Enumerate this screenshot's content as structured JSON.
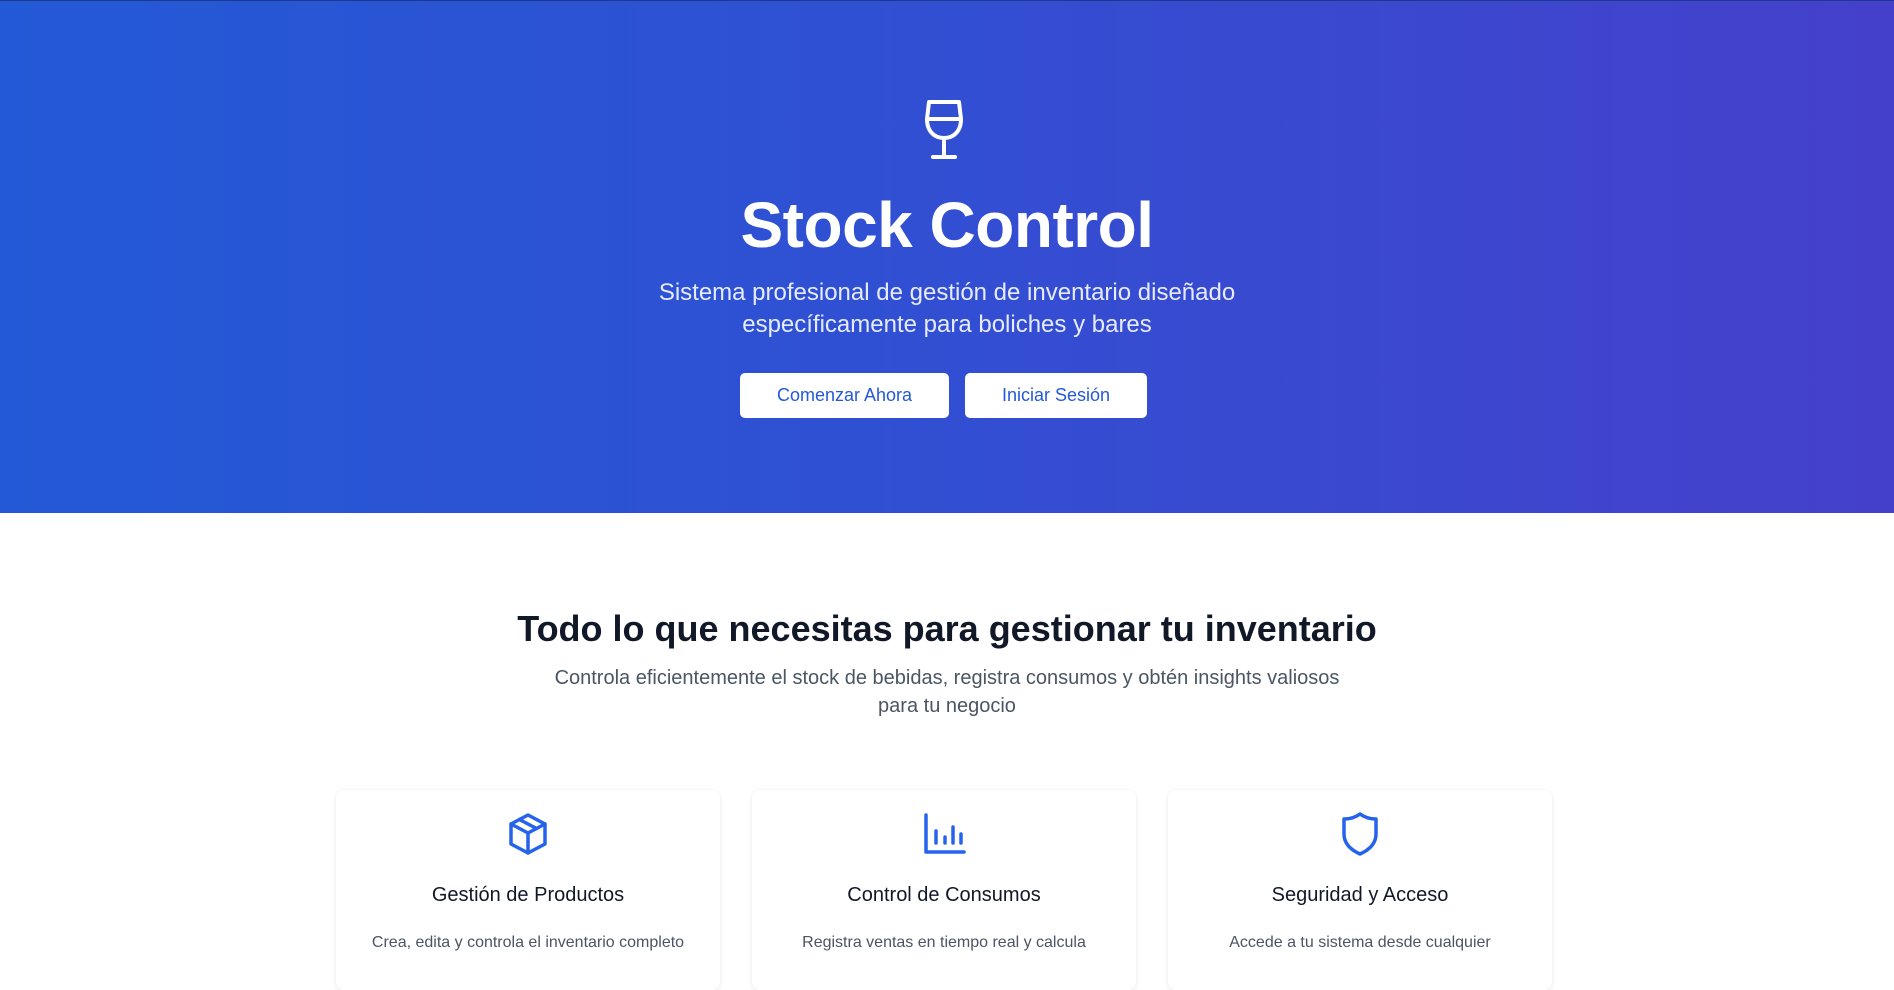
{
  "hero": {
    "icon": "wine-glass-icon",
    "title": "Stock Control",
    "subtitle": "Sistema profesional de gestión de inventario diseñado específicamente para boliches y bares",
    "buttons": {
      "start_label": "Comenzar Ahora",
      "login_label": "Iniciar Sesión"
    },
    "gradient_colors": [
      "#2359d6",
      "#4540cc"
    ]
  },
  "features": {
    "title": "Todo lo que necesitas para gestionar tu inventario",
    "subtitle": "Controla eficientemente el stock de bebidas, registra consumos y obtén insights valiosos para tu negocio",
    "accent_color": "#2563eb",
    "cards": [
      {
        "icon": "package-icon",
        "title": "Gestión de Productos",
        "text": "Crea, edita y controla el inventario completo"
      },
      {
        "icon": "bar-chart-icon",
        "title": "Control de Consumos",
        "text": "Registra ventas en tiempo real y calcula"
      },
      {
        "icon": "shield-icon",
        "title": "Seguridad y Acceso",
        "text": "Accede a tu sistema desde cualquier"
      }
    ]
  }
}
